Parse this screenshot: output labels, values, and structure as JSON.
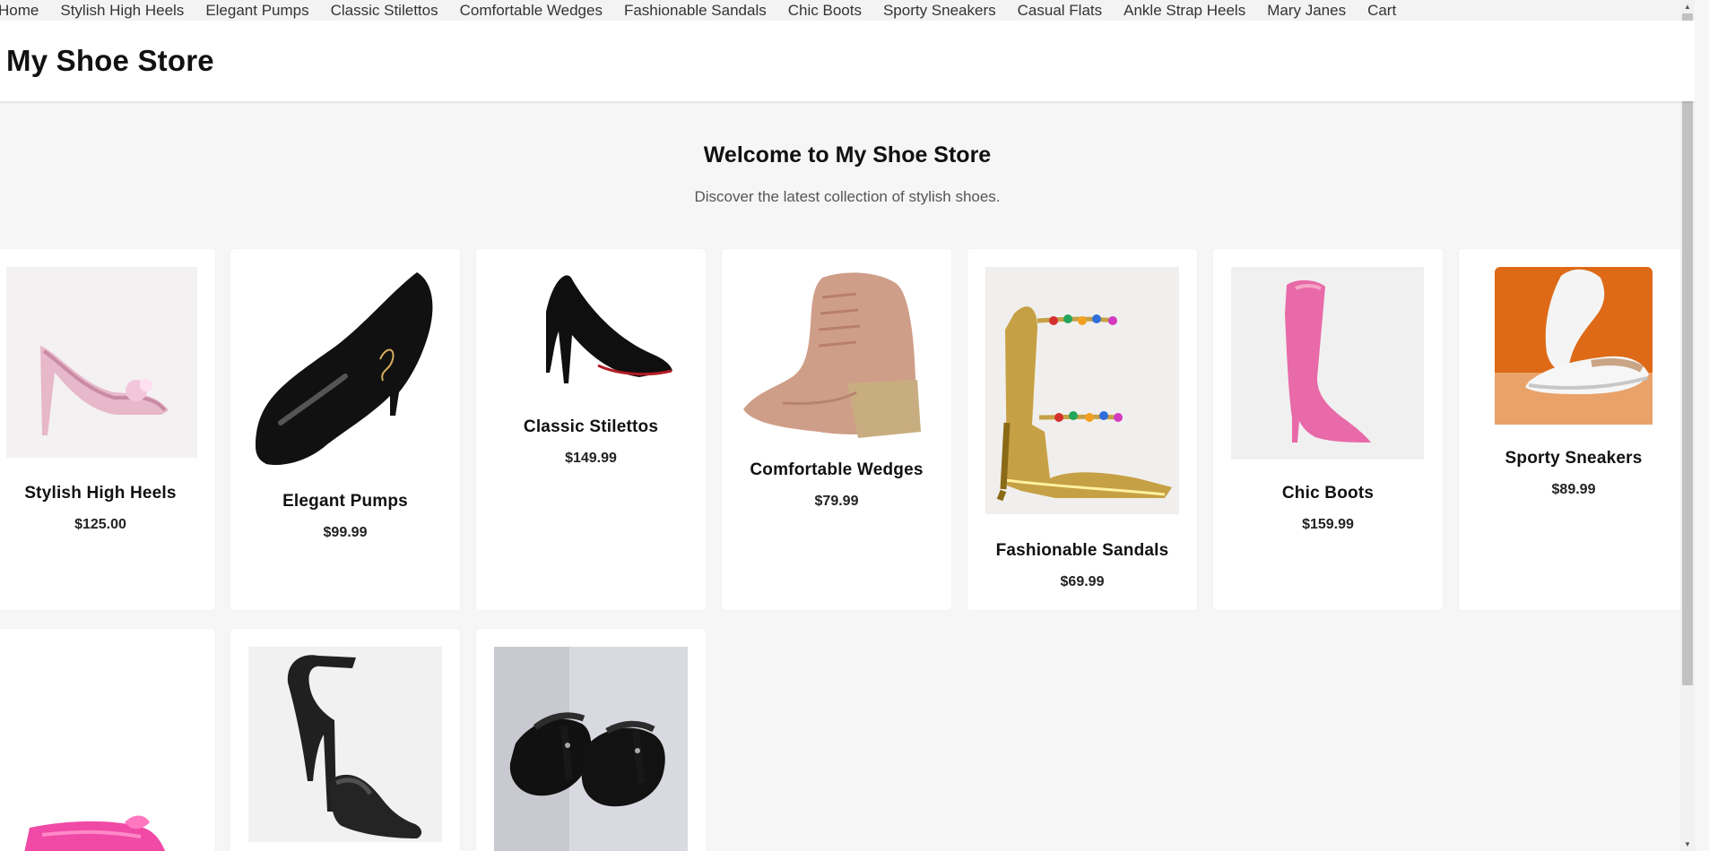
{
  "nav": {
    "items": [
      {
        "label": "Home"
      },
      {
        "label": "Stylish High Heels"
      },
      {
        "label": "Elegant Pumps"
      },
      {
        "label": "Classic Stilettos"
      },
      {
        "label": "Comfortable Wedges"
      },
      {
        "label": "Fashionable Sandals"
      },
      {
        "label": "Chic Boots"
      },
      {
        "label": "Sporty Sneakers"
      },
      {
        "label": "Casual Flats"
      },
      {
        "label": "Ankle Strap Heels"
      },
      {
        "label": "Mary Janes"
      },
      {
        "label": "Cart"
      }
    ]
  },
  "header": {
    "title": "My Shoe Store"
  },
  "hero": {
    "title": "Welcome to My Shoe Store",
    "subtitle": "Discover the latest collection of stylish shoes."
  },
  "products": [
    {
      "name": "Stylish High Heels",
      "price": "$125.00",
      "icon": "pink-glitter-heel"
    },
    {
      "name": "Elegant Pumps",
      "price": "$99.99",
      "icon": "black-patent-pump"
    },
    {
      "name": "Classic Stilettos",
      "price": "$149.99",
      "icon": "black-stiletto"
    },
    {
      "name": "Comfortable Wedges",
      "price": "$79.99",
      "icon": "tan-wedge-bootie"
    },
    {
      "name": "Fashionable Sandals",
      "price": "$69.99",
      "icon": "gold-jeweled-sandal"
    },
    {
      "name": "Chic Boots",
      "price": "$159.99",
      "icon": "pink-knee-boot"
    },
    {
      "name": "Sporty Sneakers",
      "price": "$89.99",
      "icon": "white-sneaker"
    },
    {
      "name": "",
      "price": "",
      "icon": "pink-flat-partial"
    },
    {
      "name": "",
      "price": "",
      "icon": "black-ankle-strap-heel"
    },
    {
      "name": "",
      "price": "",
      "icon": "black-mary-janes"
    }
  ],
  "colors": {
    "background": "#f6f6f6",
    "card": "#ffffff",
    "nav_text": "#333333",
    "heading": "#111111"
  }
}
